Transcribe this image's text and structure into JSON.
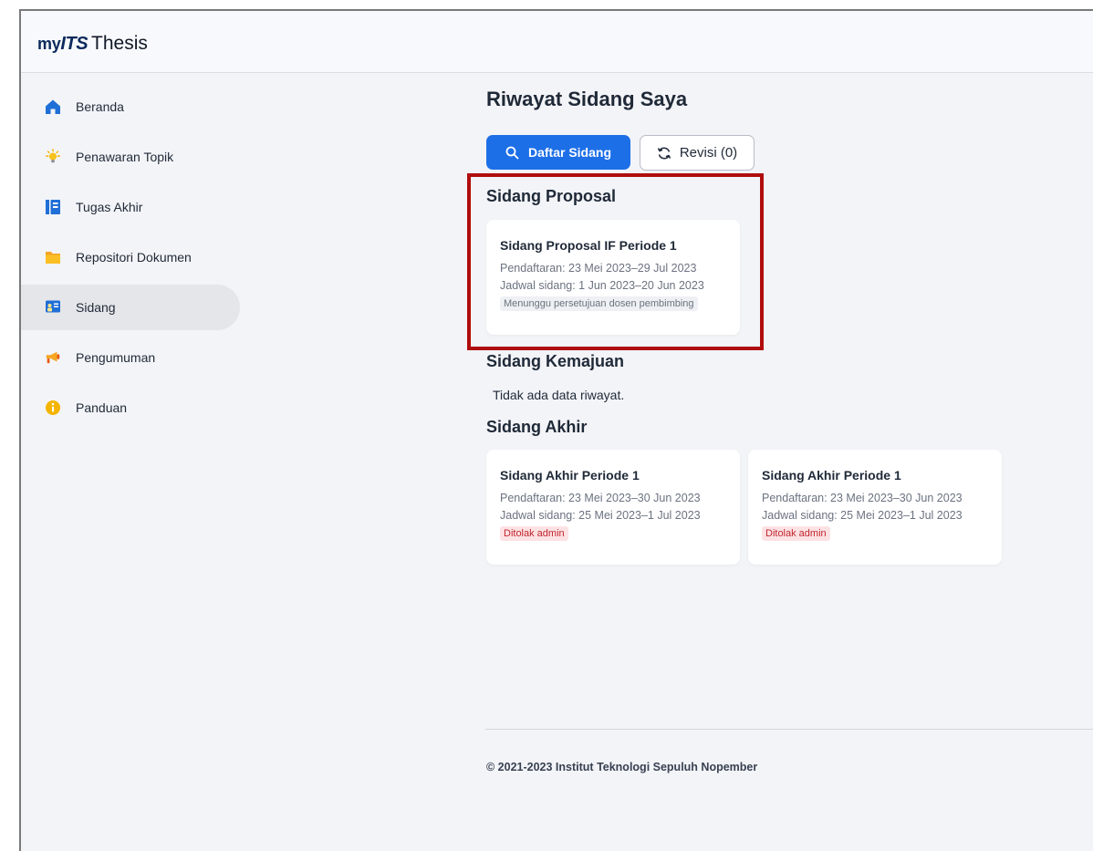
{
  "app": {
    "logo_my": "my",
    "logo_its": "ITS",
    "logo_thesis": "Thesis"
  },
  "sidebar": {
    "items": [
      {
        "label": "Beranda",
        "icon": "home-icon"
      },
      {
        "label": "Penawaran Topik",
        "icon": "lightbulb-icon"
      },
      {
        "label": "Tugas Akhir",
        "icon": "book-icon"
      },
      {
        "label": "Repositori Dokumen",
        "icon": "folder-icon"
      },
      {
        "label": "Sidang",
        "icon": "presentation-icon",
        "active": true
      },
      {
        "label": "Pengumuman",
        "icon": "megaphone-icon"
      },
      {
        "label": "Panduan",
        "icon": "info-icon"
      }
    ]
  },
  "main": {
    "title": "Riwayat Sidang Saya",
    "buttons": {
      "daftar_label": "Daftar Sidang",
      "revisi_label": "Revisi (0)"
    },
    "sections": {
      "proposal": {
        "title": "Sidang Proposal",
        "cards": [
          {
            "title": "Sidang Proposal IF Periode 1",
            "pendaftaran": "Pendaftaran: 23 Mei 2023–29 Jul 2023",
            "jadwal": "Jadwal sidang: 1 Jun 2023–20 Jun 2023",
            "status": "Menunggu persetujuan dosen pembimbing"
          }
        ]
      },
      "kemajuan": {
        "title": "Sidang Kemajuan",
        "empty": "Tidak ada data riwayat."
      },
      "akhir": {
        "title": "Sidang Akhir",
        "cards": [
          {
            "title": "Sidang Akhir Periode 1",
            "pendaftaran": "Pendaftaran: 23 Mei 2023–30 Jun 2023",
            "jadwal": "Jadwal sidang: 25 Mei 2023–1 Jul 2023",
            "status": "Ditolak admin"
          },
          {
            "title": "Sidang Akhir Periode 1",
            "pendaftaran": "Pendaftaran: 23 Mei 2023–30 Jun 2023",
            "jadwal": "Jadwal sidang: 25 Mei 2023–1 Jul 2023",
            "status": "Ditolak admin"
          }
        ]
      }
    }
  },
  "footer": {
    "copyright": "© 2021-2023 Institut Teknologi Sepuluh Nopember"
  },
  "colors": {
    "primary": "#1d6fe8",
    "highlight": "#b00d0d",
    "danger_badge": "#c0262d"
  }
}
